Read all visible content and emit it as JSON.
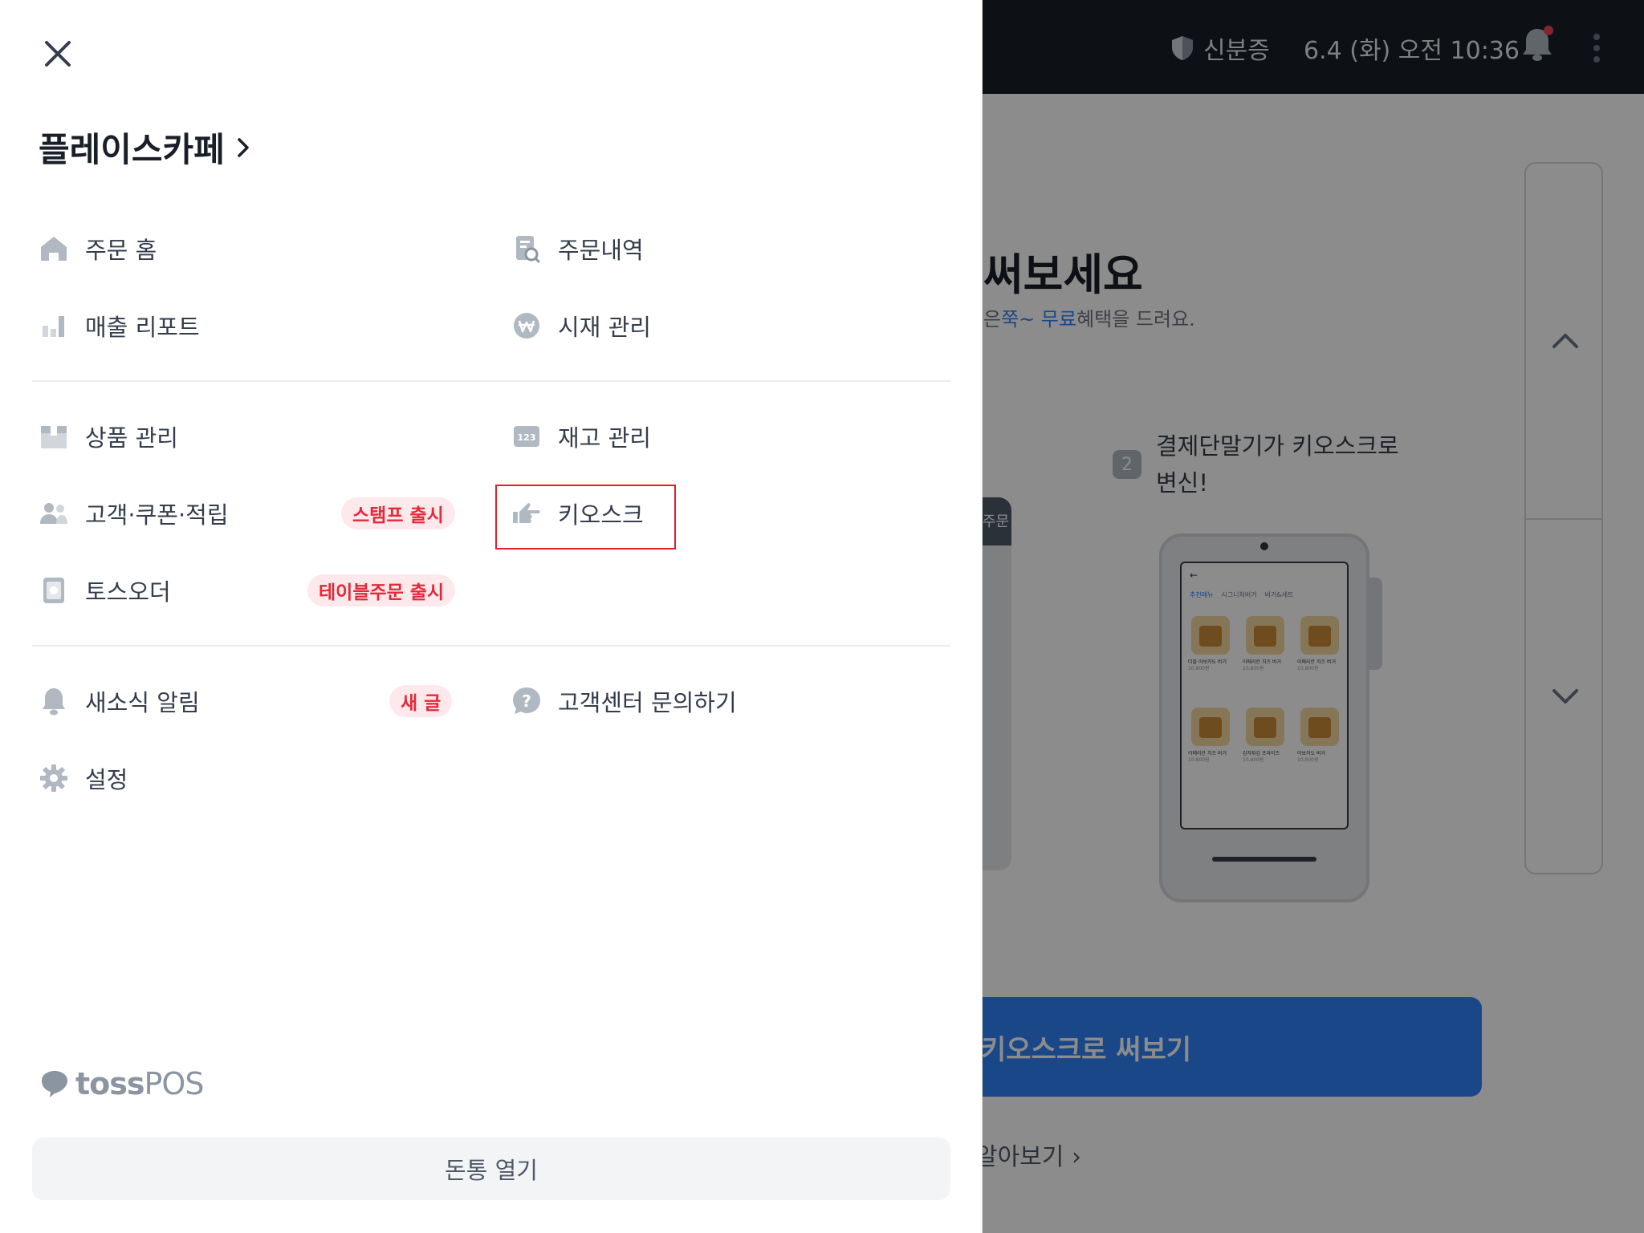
{
  "background": {
    "header": {
      "id_label": "신분증",
      "datetime": "6.4 (화) 오전 10:36"
    },
    "promo": {
      "title": "써보세요",
      "subtitle_prefix": "은",
      "subtitle_hl1": "쭉~ 무료",
      "subtitle_suffix": "혜택을 드려요.",
      "left_tab": "주문 ",
      "step_number": "2",
      "step_text": "결제단말기가 키오스크로\n변신!",
      "cta_label": "키오스크로 써보기",
      "learn_more": "알아보기"
    },
    "kiosk_screen": {
      "tabs": [
        "추천메뉴",
        "시그니처버거",
        "버거&세트"
      ],
      "items": [
        {
          "name": "더블 아보카도 버거",
          "price": "10,800원"
        },
        {
          "name": "아메리칸 치즈 버거",
          "price": "10,800원"
        },
        {
          "name": "아메리칸 치즈 버거",
          "price": "10,800원"
        },
        {
          "name": "아메리칸 치즈 버거",
          "price": "10,800원"
        },
        {
          "name": "감자튀김 프라이즈",
          "price": "10,800원"
        },
        {
          "name": "아보카도 버거",
          "price": "10,800원"
        }
      ]
    }
  },
  "drawer": {
    "store_name": "플레이스카페",
    "group1": {
      "order_home": "주문 홈",
      "order_history": "주문내역",
      "sales_report": "매출 리포트",
      "cash_mgmt": "시재 관리"
    },
    "group2": {
      "product_mgmt": "상품 관리",
      "stock_mgmt": "재고 관리",
      "customer": "고객·쿠폰·적립",
      "customer_badge": "스탬프 출시",
      "kiosk": "키오스크",
      "toss_order": "토스오더",
      "toss_order_badge": "테이블주문 출시"
    },
    "group3": {
      "news": "새소식 알림",
      "news_badge": "새 글",
      "support": "고객센터 문의하기",
      "settings": "설정"
    },
    "logo": {
      "brand": "toss",
      "product": "POS"
    },
    "open_drawer": "돈통 열기"
  },
  "colors": {
    "accent_blue": "#3182f6",
    "badge_red": "#e42939",
    "badge_bg": "#fde9ec",
    "highlight_box": "#e5202e",
    "icon_gray": "#b0b8c1"
  }
}
